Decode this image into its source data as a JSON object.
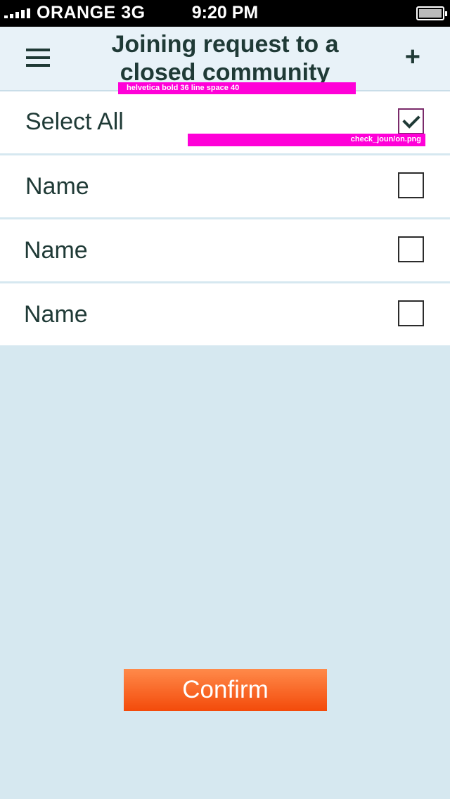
{
  "status_bar": {
    "carrier": "ORANGE",
    "network": "3G",
    "time": "9:20 PM"
  },
  "navbar": {
    "title": "Joining request to a closed community",
    "menu_icon": "hamburger-icon",
    "add_icon": "plus-icon",
    "add_glyph": "+"
  },
  "annotations": {
    "title_note": "helvetica bold 36 line space 40",
    "checkbox_note": "check_joun/on.png"
  },
  "list": {
    "items": [
      {
        "label": "Select All",
        "checked": true
      },
      {
        "label": "Name",
        "checked": false
      },
      {
        "label": "Name",
        "checked": false
      },
      {
        "label": "Name",
        "checked": false
      }
    ]
  },
  "confirm": {
    "label": "Confirm"
  },
  "colors": {
    "background": "#d6e8f0",
    "navbar": "#e8f2f8",
    "text": "#1f3a36",
    "accent": "#f35a18",
    "annotation": "#ff00d8"
  }
}
